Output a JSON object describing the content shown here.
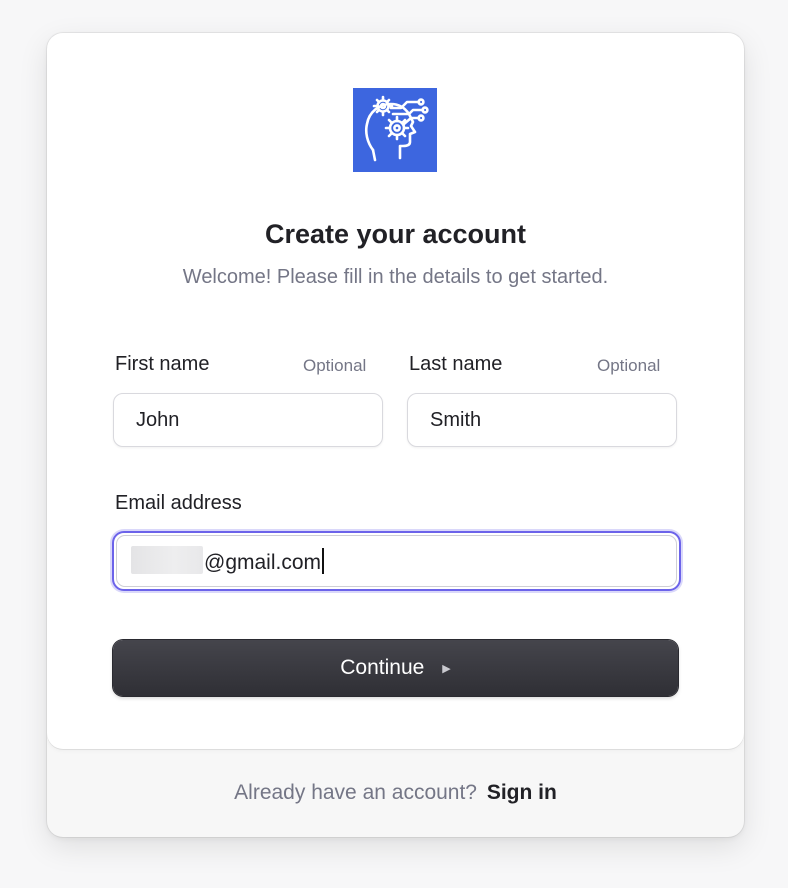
{
  "header": {
    "logo_icon": "ai-head-gears-icon",
    "brand_color": "#3d66df",
    "title": "Create your account",
    "subtitle": "Welcome! Please fill in the details to get started."
  },
  "form": {
    "first_name": {
      "label": "First name",
      "optional": "Optional",
      "value": "John"
    },
    "last_name": {
      "label": "Last name",
      "optional": "Optional",
      "value": "Smith"
    },
    "email": {
      "label": "Email address",
      "value_visible": "@gmail.com"
    },
    "focus_color": "#6c63ea"
  },
  "actions": {
    "continue_label": "Continue",
    "continue_icon": "triangle-right-icon"
  },
  "footer": {
    "prompt": "Already have an account?",
    "signin_label": "Sign in"
  }
}
